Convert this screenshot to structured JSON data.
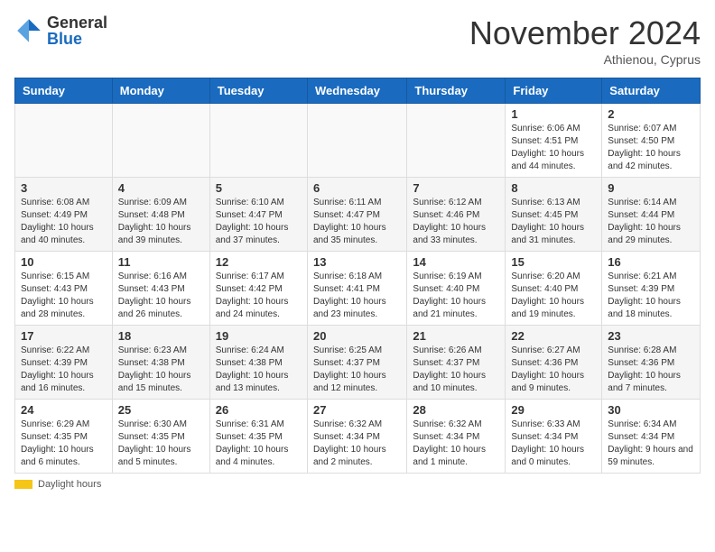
{
  "header": {
    "logo_general": "General",
    "logo_blue": "Blue",
    "month_title": "November 2024",
    "location": "Athienou, Cyprus"
  },
  "weekdays": [
    "Sunday",
    "Monday",
    "Tuesday",
    "Wednesday",
    "Thursday",
    "Friday",
    "Saturday"
  ],
  "weeks": [
    [
      {
        "day": "",
        "info": ""
      },
      {
        "day": "",
        "info": ""
      },
      {
        "day": "",
        "info": ""
      },
      {
        "day": "",
        "info": ""
      },
      {
        "day": "",
        "info": ""
      },
      {
        "day": "1",
        "info": "Sunrise: 6:06 AM\nSunset: 4:51 PM\nDaylight: 10 hours and 44 minutes."
      },
      {
        "day": "2",
        "info": "Sunrise: 6:07 AM\nSunset: 4:50 PM\nDaylight: 10 hours and 42 minutes."
      }
    ],
    [
      {
        "day": "3",
        "info": "Sunrise: 6:08 AM\nSunset: 4:49 PM\nDaylight: 10 hours and 40 minutes."
      },
      {
        "day": "4",
        "info": "Sunrise: 6:09 AM\nSunset: 4:48 PM\nDaylight: 10 hours and 39 minutes."
      },
      {
        "day": "5",
        "info": "Sunrise: 6:10 AM\nSunset: 4:47 PM\nDaylight: 10 hours and 37 minutes."
      },
      {
        "day": "6",
        "info": "Sunrise: 6:11 AM\nSunset: 4:47 PM\nDaylight: 10 hours and 35 minutes."
      },
      {
        "day": "7",
        "info": "Sunrise: 6:12 AM\nSunset: 4:46 PM\nDaylight: 10 hours and 33 minutes."
      },
      {
        "day": "8",
        "info": "Sunrise: 6:13 AM\nSunset: 4:45 PM\nDaylight: 10 hours and 31 minutes."
      },
      {
        "day": "9",
        "info": "Sunrise: 6:14 AM\nSunset: 4:44 PM\nDaylight: 10 hours and 29 minutes."
      }
    ],
    [
      {
        "day": "10",
        "info": "Sunrise: 6:15 AM\nSunset: 4:43 PM\nDaylight: 10 hours and 28 minutes."
      },
      {
        "day": "11",
        "info": "Sunrise: 6:16 AM\nSunset: 4:43 PM\nDaylight: 10 hours and 26 minutes."
      },
      {
        "day": "12",
        "info": "Sunrise: 6:17 AM\nSunset: 4:42 PM\nDaylight: 10 hours and 24 minutes."
      },
      {
        "day": "13",
        "info": "Sunrise: 6:18 AM\nSunset: 4:41 PM\nDaylight: 10 hours and 23 minutes."
      },
      {
        "day": "14",
        "info": "Sunrise: 6:19 AM\nSunset: 4:40 PM\nDaylight: 10 hours and 21 minutes."
      },
      {
        "day": "15",
        "info": "Sunrise: 6:20 AM\nSunset: 4:40 PM\nDaylight: 10 hours and 19 minutes."
      },
      {
        "day": "16",
        "info": "Sunrise: 6:21 AM\nSunset: 4:39 PM\nDaylight: 10 hours and 18 minutes."
      }
    ],
    [
      {
        "day": "17",
        "info": "Sunrise: 6:22 AM\nSunset: 4:39 PM\nDaylight: 10 hours and 16 minutes."
      },
      {
        "day": "18",
        "info": "Sunrise: 6:23 AM\nSunset: 4:38 PM\nDaylight: 10 hours and 15 minutes."
      },
      {
        "day": "19",
        "info": "Sunrise: 6:24 AM\nSunset: 4:38 PM\nDaylight: 10 hours and 13 minutes."
      },
      {
        "day": "20",
        "info": "Sunrise: 6:25 AM\nSunset: 4:37 PM\nDaylight: 10 hours and 12 minutes."
      },
      {
        "day": "21",
        "info": "Sunrise: 6:26 AM\nSunset: 4:37 PM\nDaylight: 10 hours and 10 minutes."
      },
      {
        "day": "22",
        "info": "Sunrise: 6:27 AM\nSunset: 4:36 PM\nDaylight: 10 hours and 9 minutes."
      },
      {
        "day": "23",
        "info": "Sunrise: 6:28 AM\nSunset: 4:36 PM\nDaylight: 10 hours and 7 minutes."
      }
    ],
    [
      {
        "day": "24",
        "info": "Sunrise: 6:29 AM\nSunset: 4:35 PM\nDaylight: 10 hours and 6 minutes."
      },
      {
        "day": "25",
        "info": "Sunrise: 6:30 AM\nSunset: 4:35 PM\nDaylight: 10 hours and 5 minutes."
      },
      {
        "day": "26",
        "info": "Sunrise: 6:31 AM\nSunset: 4:35 PM\nDaylight: 10 hours and 4 minutes."
      },
      {
        "day": "27",
        "info": "Sunrise: 6:32 AM\nSunset: 4:34 PM\nDaylight: 10 hours and 2 minutes."
      },
      {
        "day": "28",
        "info": "Sunrise: 6:32 AM\nSunset: 4:34 PM\nDaylight: 10 hours and 1 minute."
      },
      {
        "day": "29",
        "info": "Sunrise: 6:33 AM\nSunset: 4:34 PM\nDaylight: 10 hours and 0 minutes."
      },
      {
        "day": "30",
        "info": "Sunrise: 6:34 AM\nSunset: 4:34 PM\nDaylight: 9 hours and 59 minutes."
      }
    ]
  ],
  "footer": {
    "daylight_label": "Daylight hours"
  }
}
